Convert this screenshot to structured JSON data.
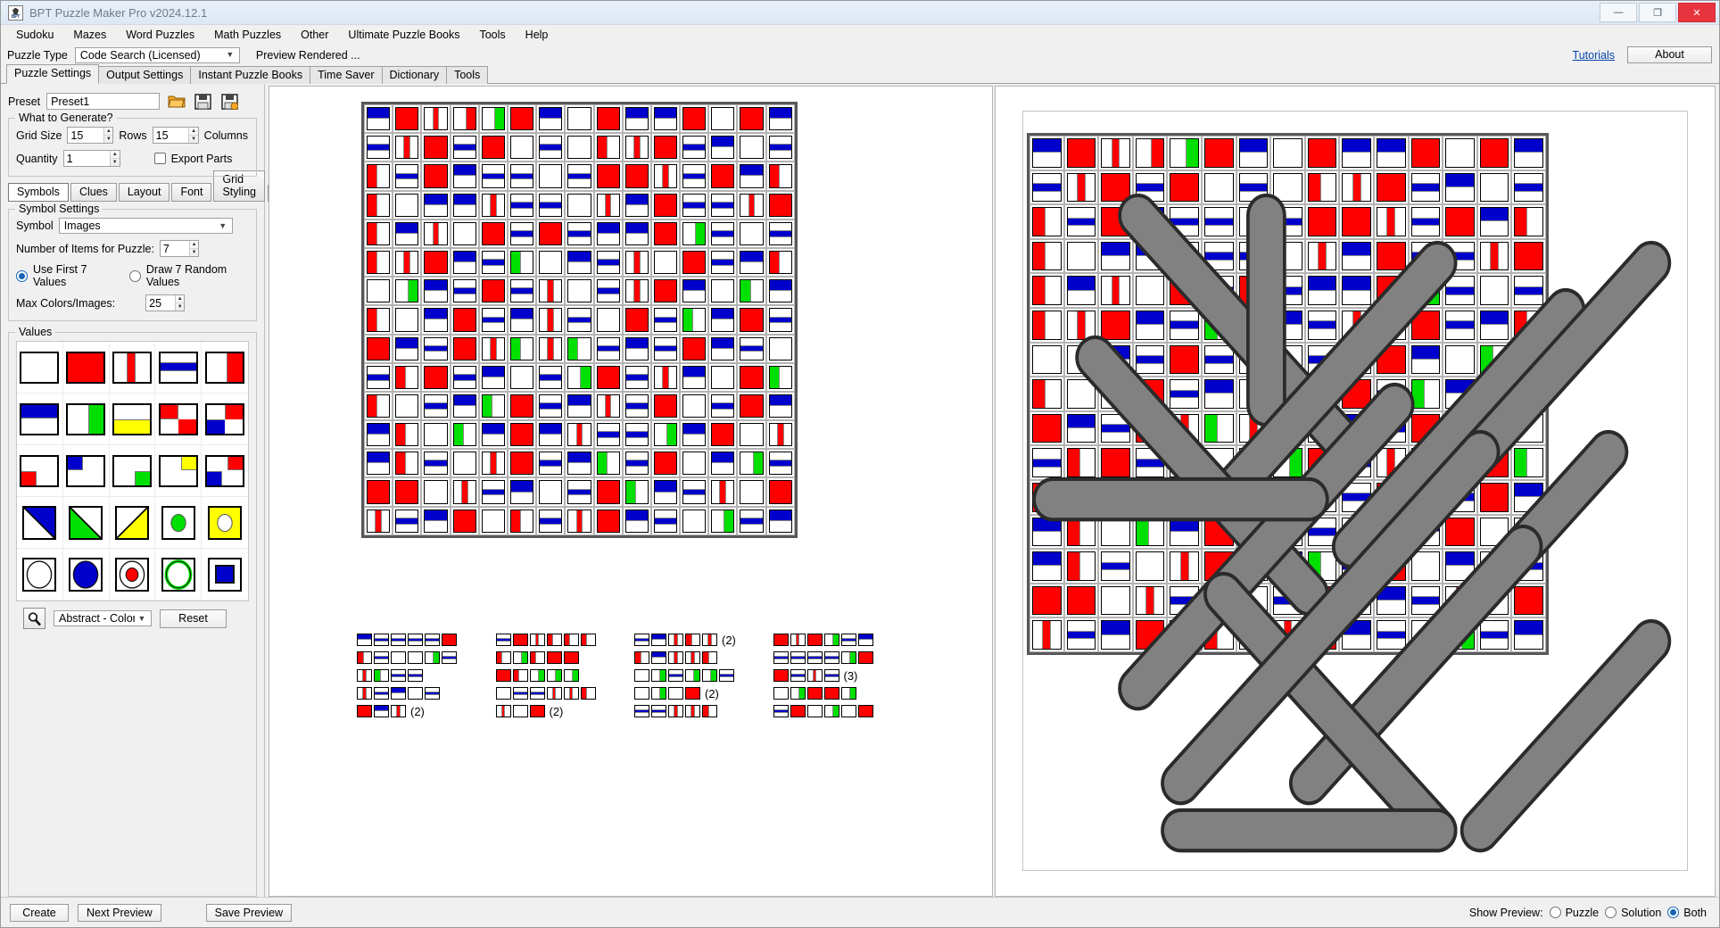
{
  "window": {
    "title": "BPT Puzzle Maker Pro v2024.12.1",
    "icon": "app-icon",
    "minimize": "—",
    "maximize": "❐",
    "close": "✕"
  },
  "menubar": {
    "items": [
      {
        "label": "Sudoku"
      },
      {
        "label": "Mazes"
      },
      {
        "label": "Word Puzzles"
      },
      {
        "label": "Math Puzzles"
      },
      {
        "label": "Other"
      },
      {
        "label": "Ultimate Puzzle Books"
      },
      {
        "label": "Tools"
      },
      {
        "label": "Help"
      }
    ]
  },
  "puzzle_type_row": {
    "label": "Puzzle Type",
    "selected": "Code Search (Licensed)",
    "preview_rendered": "Preview Rendered ...",
    "tutorials_link": "Tutorials",
    "about_button": "About"
  },
  "main_tabs": [
    {
      "label": "Puzzle Settings",
      "active": true
    },
    {
      "label": "Output Settings",
      "active": false
    },
    {
      "label": "Instant Puzzle Books",
      "active": false
    },
    {
      "label": "Time Saver",
      "active": false
    },
    {
      "label": "Dictionary",
      "active": false
    },
    {
      "label": "Tools",
      "active": false
    }
  ],
  "preset": {
    "label": "Preset",
    "value": "Preset1",
    "open_icon": "folder-open-icon",
    "save_icon": "save-icon",
    "save_as_icon": "save-as-icon"
  },
  "what_to_generate": {
    "legend": "What to Generate?",
    "grid_size_label": "Grid Size",
    "grid_size_value": "15",
    "rows_label": "Rows",
    "rows_value": "15",
    "columns_label": "Columns",
    "quantity_label": "Quantity",
    "quantity_value": "1",
    "export_parts_label": "Export Parts",
    "export_parts_checked": false
  },
  "inner_tabs": [
    {
      "label": "Symbols",
      "active": true
    },
    {
      "label": "Clues",
      "active": false
    },
    {
      "label": "Layout",
      "active": false
    },
    {
      "label": "Font",
      "active": false
    },
    {
      "label": "Grid Styling",
      "active": false
    }
  ],
  "inner_tab_nav": {
    "prev": "◄",
    "next": "►"
  },
  "symbol_settings": {
    "legend": "Symbol Settings",
    "symbol_label": "Symbol",
    "symbol_value": "Images",
    "number_items_label": "Number of Items for Puzzle:",
    "number_items_value": "7",
    "use_first_label": "Use First 7 Values",
    "use_first_selected": true,
    "draw_random_label": "Draw 7 Random Values",
    "draw_random_selected": false,
    "max_colors_label": "Max Colors/Images:",
    "max_colors_value": "25"
  },
  "values": {
    "legend": "Values",
    "search_icon": "magnifier-icon",
    "category": "Abstract - Color",
    "reset_button": "Reset",
    "tiles": [
      {
        "type": "solid",
        "color": "#ffffff"
      },
      {
        "type": "solid",
        "color": "#ff0000"
      },
      {
        "type": "vbar",
        "color": "#ff0000"
      },
      {
        "type": "hbar",
        "color": "#0000cc"
      },
      {
        "type": "vhalf-right",
        "color": "#ff0000"
      },
      {
        "type": "hhalf-top",
        "color": "#0000cc"
      },
      {
        "type": "vhalf-right",
        "color": "#00e000"
      },
      {
        "type": "hhalf-bottom",
        "color": "#ffff00"
      },
      {
        "type": "quad-diag",
        "color": "#ff0000"
      },
      {
        "type": "quad-blue-red",
        "color": "#0000cc"
      },
      {
        "type": "corner-bl",
        "color": "#ff0000"
      },
      {
        "type": "corner-tl",
        "color": "#0000cc"
      },
      {
        "type": "corner-br",
        "color": "#00e000"
      },
      {
        "type": "corner-tr",
        "color": "#ffff00"
      },
      {
        "type": "corner-tr-red",
        "color": "#ff0000"
      },
      {
        "type": "tri-ur",
        "color": "#0000cc"
      },
      {
        "type": "tri-ll",
        "color": "#00e000"
      },
      {
        "type": "tri-lr",
        "color": "#ffff00"
      },
      {
        "type": "circle",
        "color": "#00e000",
        "bg": "#ffffff"
      },
      {
        "type": "circle",
        "color": "#ffffff",
        "bg": "#ffff00"
      },
      {
        "type": "circle-big",
        "color": "#ffffff",
        "bg": "#ffffff"
      },
      {
        "type": "circle-big",
        "color": "#0000cc",
        "bg": "#ffffff"
      },
      {
        "type": "circle-ring",
        "color": "#ff0000",
        "bg": "#ffffff"
      },
      {
        "type": "circle-ring-green",
        "color": "#ffffff",
        "bg": "#ffffff"
      },
      {
        "type": "square-in",
        "color": "#ffffff",
        "bg": "#0000cc"
      }
    ]
  },
  "bottom_bar": {
    "create_button": "Create",
    "next_preview_button": "Next Preview",
    "save_preview_button": "Save Preview",
    "show_preview_label": "Show Preview:",
    "options": [
      {
        "label": "Puzzle",
        "selected": false
      },
      {
        "label": "Solution",
        "selected": false
      },
      {
        "label": "Both",
        "selected": true
      }
    ]
  },
  "puzzle": {
    "rows": 15,
    "cols": 15,
    "cells": [
      [
        "hb",
        "s-r",
        "vb-r",
        "vr-r",
        "vr-g",
        "s-r",
        "hb",
        "w",
        "s-r",
        "hb",
        "hb",
        "s-r",
        "w",
        "s-r",
        "hb"
      ],
      [
        "hm",
        "vb-r",
        "s-r",
        "hm",
        "s-r",
        "w",
        "hm",
        "w",
        "vl-r",
        "vb-r",
        "s-r",
        "hm",
        "hb",
        "w",
        "hm"
      ],
      [
        "vl-r",
        "hm",
        "s-r",
        "hb",
        "hm",
        "hm",
        "w",
        "hm",
        "s-r",
        "s-r",
        "vb-r",
        "hm",
        "s-r",
        "hb",
        "vl-r"
      ],
      [
        "vl-r",
        "w",
        "hb",
        "hb",
        "vb-r",
        "hm",
        "hm",
        "w",
        "vb-r",
        "hb",
        "s-r",
        "hm",
        "hm",
        "vb-r",
        "s-r"
      ],
      [
        "vl-r",
        "hb",
        "vb-r",
        "w",
        "s-r",
        "hm",
        "s-r",
        "hm",
        "hb",
        "hb",
        "s-r",
        "vr-g",
        "hm",
        "w",
        "hm"
      ],
      [
        "vl-r",
        "vb-r",
        "s-r",
        "hb",
        "hm",
        "vl-g",
        "w",
        "hb",
        "hm",
        "vb-r",
        "w",
        "s-r",
        "hm",
        "hb",
        "vl-r"
      ],
      [
        "w",
        "vr-g",
        "hb",
        "hm",
        "s-r",
        "hm",
        "vb-r",
        "w",
        "hm",
        "vb-r",
        "s-r",
        "hb",
        "w",
        "vl-g",
        "hb"
      ],
      [
        "vl-r",
        "w",
        "hb",
        "s-r",
        "hm",
        "hb",
        "vb-r",
        "hm",
        "w",
        "s-r",
        "hm",
        "vl-g",
        "hb",
        "s-r",
        "hm"
      ],
      [
        "s-r",
        "hb",
        "hm",
        "s-r",
        "vb-r",
        "vl-g",
        "vb-r",
        "vl-g",
        "hm",
        "hb",
        "hm",
        "s-r",
        "hb",
        "hm",
        "w"
      ],
      [
        "hm",
        "vl-r",
        "s-r",
        "hm",
        "hb",
        "w",
        "hm",
        "vr-g",
        "s-r",
        "hm",
        "vb-r",
        "hb",
        "w",
        "s-r",
        "vl-g"
      ],
      [
        "vl-r",
        "w",
        "hm",
        "hb",
        "vl-g",
        "s-r",
        "hm",
        "hb",
        "vb-r",
        "hm",
        "s-r",
        "w",
        "hm",
        "s-r",
        "hb"
      ],
      [
        "hb",
        "vl-r",
        "w",
        "vl-g",
        "hb",
        "s-r",
        "hb",
        "vb-r",
        "hm",
        "hm",
        "vr-g",
        "hb",
        "s-r",
        "w",
        "vb-r"
      ],
      [
        "hb",
        "vl-r",
        "hm",
        "w",
        "vb-r",
        "s-r",
        "hm",
        "hb",
        "vl-g",
        "hm",
        "s-r",
        "w",
        "hb",
        "vr-g",
        "hm"
      ],
      [
        "s-r",
        "s-r",
        "w",
        "vb-r",
        "hm",
        "hb",
        "w",
        "hm",
        "s-r",
        "vl-g",
        "hb",
        "hm",
        "vb-r",
        "w",
        "s-r"
      ],
      [
        "vb-r",
        "hm",
        "hb",
        "s-r",
        "w",
        "vl-r",
        "hm",
        "vb-r",
        "s-r",
        "hb",
        "hm",
        "w",
        "vr-g",
        "hm",
        "hb"
      ]
    ]
  },
  "clue_list": {
    "columns": 4,
    "items": [
      {
        "symbols": [
          "hb",
          "hm",
          "hm",
          "hm",
          "hm",
          "s-r"
        ],
        "count": ""
      },
      {
        "symbols": [
          "vl-r",
          "hm",
          "w",
          "w",
          "vr-g",
          "hm"
        ],
        "count": ""
      },
      {
        "symbols": [
          "vb-r",
          "vl-g",
          "hm",
          "hm"
        ],
        "count": ""
      },
      {
        "symbols": [
          "vb-r",
          "hm",
          "hb",
          "w",
          "hm"
        ],
        "count": ""
      },
      {
        "symbols": [
          "s-r",
          "hb",
          "vb-r"
        ],
        "count": "(2)"
      },
      {
        "symbols": [
          "hm",
          "s-r",
          "vb-r",
          "vl-r",
          "vl-r",
          "vl-r"
        ],
        "count": ""
      },
      {
        "symbols": [
          "vl-r",
          "vr-g",
          "vl-r",
          "s-r",
          "s-r"
        ],
        "count": ""
      },
      {
        "symbols": [
          "s-r",
          "vl-r",
          "vr-g",
          "vr-g",
          "vr-g"
        ],
        "count": ""
      },
      {
        "symbols": [
          "w",
          "hm",
          "hm",
          "vb-r",
          "vb-r",
          "vl-r"
        ],
        "count": ""
      },
      {
        "symbols": [
          "vb-r",
          "w",
          "s-r"
        ],
        "count": "(2)"
      },
      {
        "symbols": [
          "hm",
          "hb",
          "vb-r",
          "vl-r",
          "vb-r"
        ],
        "count": "(2)"
      },
      {
        "symbols": [
          "vl-r",
          "hb",
          "vb-r",
          "vb-r",
          "vl-r"
        ],
        "count": ""
      },
      {
        "symbols": [
          "w",
          "vr-g",
          "hm",
          "vr-g",
          "vr-g",
          "hm"
        ],
        "count": ""
      },
      {
        "symbols": [
          "w",
          "vr-g",
          "w",
          "s-r"
        ],
        "count": "(2)"
      },
      {
        "symbols": [
          "hm",
          "hm",
          "vb-r",
          "vb-r",
          "vl-r"
        ],
        "count": ""
      },
      {
        "symbols": [
          "s-r",
          "vb-r",
          "s-r",
          "vr-g",
          "hm",
          "hb"
        ],
        "count": ""
      },
      {
        "symbols": [
          "hm",
          "hm",
          "hm",
          "hm",
          "vr-g",
          "s-r"
        ],
        "count": ""
      },
      {
        "symbols": [
          "s-r",
          "hm",
          "vb-r",
          "hm"
        ],
        "count": "(3)"
      },
      {
        "symbols": [
          "w",
          "vr-g",
          "s-r",
          "s-r",
          "vr-g"
        ],
        "count": ""
      },
      {
        "symbols": [
          "hm",
          "s-r",
          "w",
          "vr-g",
          "w",
          "s-r"
        ],
        "count": ""
      }
    ]
  },
  "solution": {
    "rows": 15,
    "cols": 15,
    "highlight_color": "#c9c9c9",
    "stroke_color": "#2b2b2b",
    "words": [
      {
        "r1": 1,
        "c1": 2,
        "r2": 6,
        "c2": 7
      },
      {
        "r1": 1,
        "c1": 5,
        "r2": 5,
        "c2": 5
      },
      {
        "r1": 2,
        "c1": 9,
        "r2": 7,
        "c2": 4
      },
      {
        "r1": 3,
        "c1": 12,
        "r2": 8,
        "c2": 7
      },
      {
        "r1": 4,
        "c1": 1,
        "r2": 9,
        "c2": 6
      },
      {
        "r1": 5,
        "c1": 8,
        "r2": 11,
        "c2": 2
      },
      {
        "r1": 6,
        "c1": 13,
        "r2": 12,
        "c2": 7
      },
      {
        "r1": 7,
        "c1": 0,
        "r2": 7,
        "c2": 6
      },
      {
        "r1": 8,
        "c1": 11,
        "r2": 13,
        "c2": 6
      },
      {
        "r1": 9,
        "c1": 4,
        "r2": 14,
        "c2": 9
      },
      {
        "r1": 10,
        "c1": 14,
        "r2": 14,
        "c2": 10
      },
      {
        "r1": 14,
        "c1": 3,
        "r2": 14,
        "c2": 9
      },
      {
        "r1": 2,
        "c1": 14,
        "r2": 8,
        "c2": 8
      },
      {
        "r1": 6,
        "c1": 10,
        "r2": 13,
        "c2": 3
      }
    ]
  },
  "colors": {
    "red": "#ff0000",
    "blue": "#0000cc",
    "green": "#00e000",
    "yellow": "#ffff00",
    "white": "#ffffff",
    "accent": "#1463b4",
    "link": "#0645ad"
  }
}
